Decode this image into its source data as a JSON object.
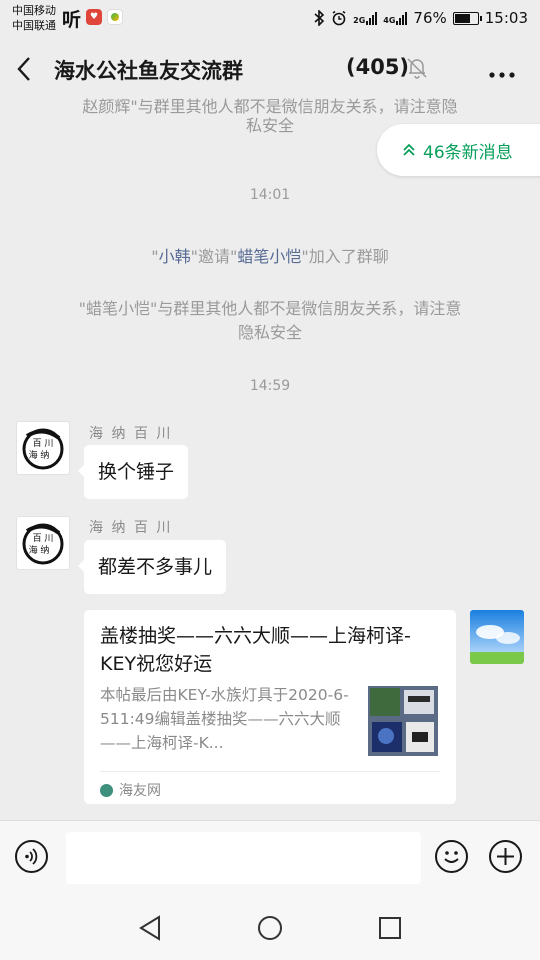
{
  "status_bar": {
    "carrier1": "中国移动",
    "carrier2": "中国联通",
    "ting": "听",
    "signal_tag_a": "2G",
    "signal_tag_b": "4G",
    "battery_percent": "76%",
    "battery_level": 76,
    "time": "15:03",
    "icons": [
      "bluetooth-icon",
      "alarm-icon",
      "signal-icon",
      "battery-icon"
    ]
  },
  "header": {
    "back_icon": "chevron-left-icon",
    "title": "海水公社鱼友交流群",
    "member_count": "(405)",
    "mute_icon": "bell-muted-icon",
    "more_icon": "more-icon"
  },
  "new_messages": {
    "label": "46条新消息",
    "icon": "double-chevron-up-icon",
    "color": "#07a05a"
  },
  "chat": {
    "sys_top": {
      "line1": "赵颜辉\"与群里其他人都不是微信朋友关系，请注意隐",
      "line2": "私安全"
    },
    "time1": "14:01",
    "invite": {
      "q1": "\"",
      "name1": "小韩",
      "mid": "\"邀请\"",
      "name2": "蜡笔小恺",
      "end": "\"加入了群聊"
    },
    "sys_notice": {
      "line1": "\"蜡笔小恺\"与群里其他人都不是微信朋友关系，请注意",
      "line2": "隐私安全"
    },
    "time2": "14:59",
    "messages": [
      {
        "sender": "海 纳 百 川",
        "text": "换个锤子"
      },
      {
        "sender": "海 纳 百 川",
        "text": "都差不多事儿"
      }
    ],
    "card": {
      "title": "盖楼抽奖——六六大顺——上海柯译-KEY祝您好运",
      "desc": "本帖最后由KEY-水族灯具于2020-6-511:49编辑盖楼抽奖——六六大顺——上海柯译-K...",
      "source": "海友网"
    }
  },
  "input_bar": {
    "voice_icon": "voice-icon",
    "emoji_icon": "emoji-icon",
    "plus_icon": "plus-icon"
  },
  "nav_bar": {
    "back_icon": "triangle-back-icon",
    "home_icon": "circle-home-icon",
    "recents_icon": "square-recents-icon"
  },
  "colors": {
    "background": "#ededed",
    "link": "#576b95",
    "accent": "#07a05a"
  }
}
